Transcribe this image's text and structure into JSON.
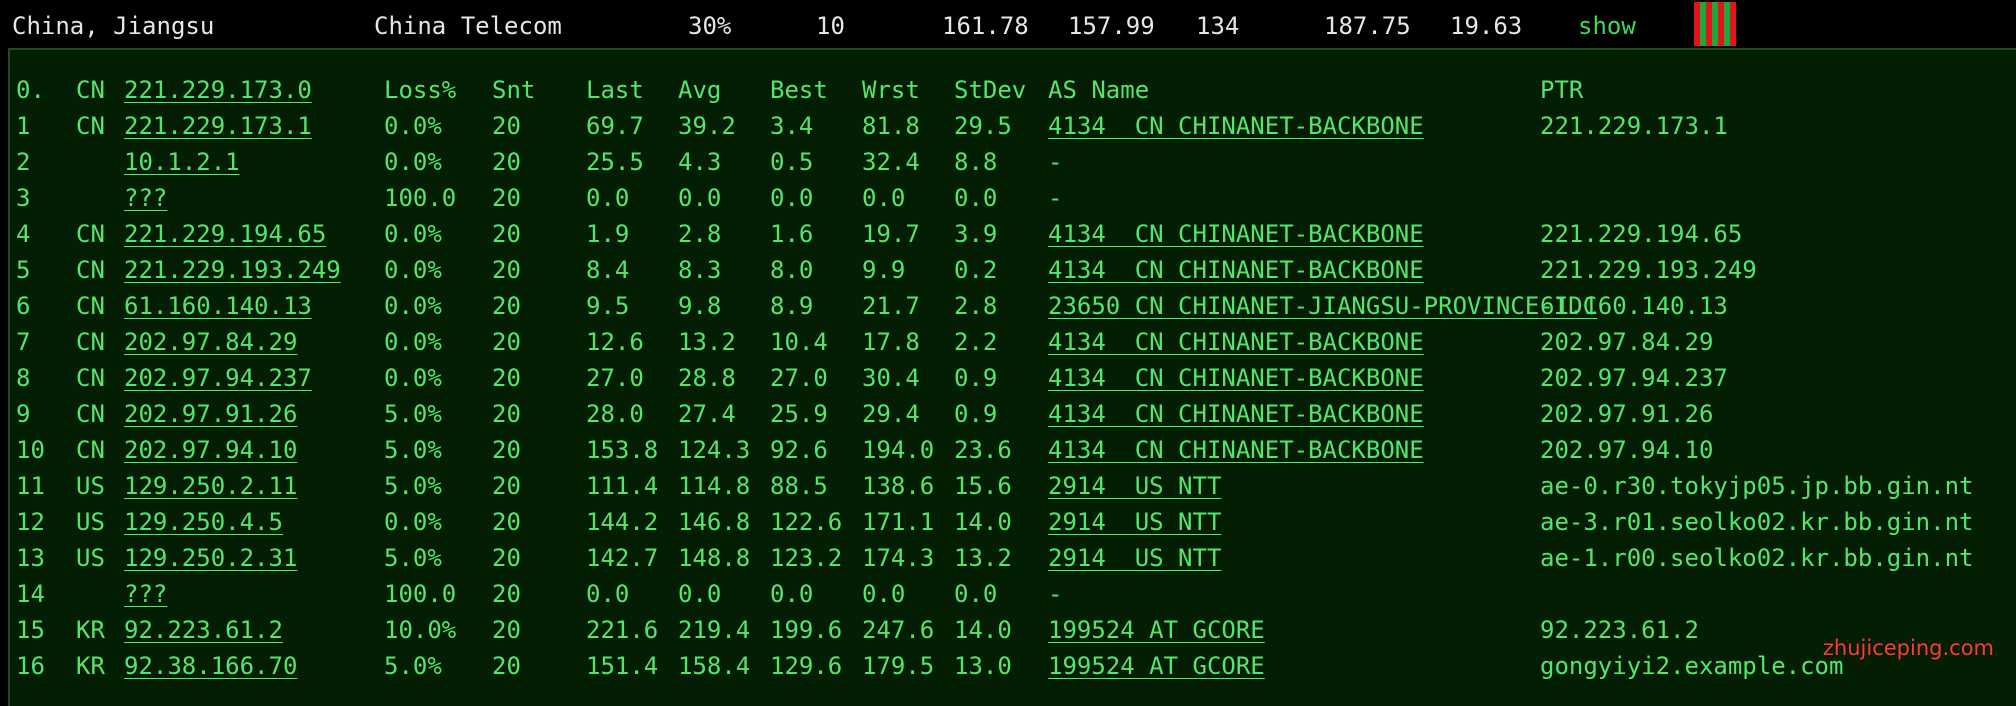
{
  "summary": {
    "location": "China, Jiangsu",
    "isp": "China Telecom",
    "loss": "30%",
    "sent": "10",
    "last": "161.78",
    "avg": "157.99",
    "best": "134",
    "worst": "187.75",
    "stdev": "19.63",
    "show_label": "show",
    "spark_bars": [
      1,
      0.35,
      1,
      0.35,
      1,
      0.35,
      1
    ]
  },
  "mtr": {
    "headers": {
      "hop": "0.",
      "cc": "CN",
      "host": "221.229.173.0",
      "loss": "Loss%",
      "snt": "Snt",
      "last": "Last",
      "avg": "Avg",
      "best": "Best",
      "wrst": "Wrst",
      "stdev": "StDev",
      "asname": "AS Name",
      "ptr": "PTR"
    },
    "rows": [
      {
        "hop": "1",
        "cc": "CN",
        "host": "221.229.173.1",
        "loss": "0.0%",
        "snt": "20",
        "last": "69.7",
        "avg": "39.2",
        "best": "3.4",
        "wrst": "81.8",
        "stdev": "29.5",
        "asname": "4134  CN CHINANET-BACKBONE",
        "ptr": "221.229.173.1"
      },
      {
        "hop": "2",
        "cc": "",
        "host": "10.1.2.1",
        "loss": "0.0%",
        "snt": "20",
        "last": "25.5",
        "avg": "4.3",
        "best": "0.5",
        "wrst": "32.4",
        "stdev": "8.8",
        "asname": "-",
        "ptr": ""
      },
      {
        "hop": "3",
        "cc": "",
        "host": "???",
        "loss": "100.0",
        "snt": "20",
        "last": "0.0",
        "avg": "0.0",
        "best": "0.0",
        "wrst": "0.0",
        "stdev": "0.0",
        "asname": "-",
        "ptr": ""
      },
      {
        "hop": "4",
        "cc": "CN",
        "host": "221.229.194.65",
        "loss": "0.0%",
        "snt": "20",
        "last": "1.9",
        "avg": "2.8",
        "best": "1.6",
        "wrst": "19.7",
        "stdev": "3.9",
        "asname": "4134  CN CHINANET-BACKBONE",
        "ptr": "221.229.194.65"
      },
      {
        "hop": "5",
        "cc": "CN",
        "host": "221.229.193.249",
        "loss": "0.0%",
        "snt": "20",
        "last": "8.4",
        "avg": "8.3",
        "best": "8.0",
        "wrst": "9.9",
        "stdev": "0.2",
        "asname": "4134  CN CHINANET-BACKBONE",
        "ptr": "221.229.193.249"
      },
      {
        "hop": "6",
        "cc": "CN",
        "host": "61.160.140.13",
        "loss": "0.0%",
        "snt": "20",
        "last": "9.5",
        "avg": "9.8",
        "best": "8.9",
        "wrst": "21.7",
        "stdev": "2.8",
        "asname": "23650 CN CHINANET-JIANGSU-PROVINCE-IDC",
        "ptr": "61.160.140.13"
      },
      {
        "hop": "7",
        "cc": "CN",
        "host": "202.97.84.29",
        "loss": "0.0%",
        "snt": "20",
        "last": "12.6",
        "avg": "13.2",
        "best": "10.4",
        "wrst": "17.8",
        "stdev": "2.2",
        "asname": "4134  CN CHINANET-BACKBONE",
        "ptr": "202.97.84.29"
      },
      {
        "hop": "8",
        "cc": "CN",
        "host": "202.97.94.237",
        "loss": "0.0%",
        "snt": "20",
        "last": "27.0",
        "avg": "28.8",
        "best": "27.0",
        "wrst": "30.4",
        "stdev": "0.9",
        "asname": "4134  CN CHINANET-BACKBONE",
        "ptr": "202.97.94.237"
      },
      {
        "hop": "9",
        "cc": "CN",
        "host": "202.97.91.26",
        "loss": "5.0%",
        "snt": "20",
        "last": "28.0",
        "avg": "27.4",
        "best": "25.9",
        "wrst": "29.4",
        "stdev": "0.9",
        "asname": "4134  CN CHINANET-BACKBONE",
        "ptr": "202.97.91.26"
      },
      {
        "hop": "10",
        "cc": "CN",
        "host": "202.97.94.10",
        "loss": "5.0%",
        "snt": "20",
        "last": "153.8",
        "avg": "124.3",
        "best": "92.6",
        "wrst": "194.0",
        "stdev": "23.6",
        "asname": "4134  CN CHINANET-BACKBONE",
        "ptr": "202.97.94.10"
      },
      {
        "hop": "11",
        "cc": "US",
        "host": "129.250.2.11",
        "loss": "5.0%",
        "snt": "20",
        "last": "111.4",
        "avg": "114.8",
        "best": "88.5",
        "wrst": "138.6",
        "stdev": "15.6",
        "asname": "2914  US NTT",
        "ptr": "ae-0.r30.tokyjp05.jp.bb.gin.nt"
      },
      {
        "hop": "12",
        "cc": "US",
        "host": "129.250.4.5",
        "loss": "0.0%",
        "snt": "20",
        "last": "144.2",
        "avg": "146.8",
        "best": "122.6",
        "wrst": "171.1",
        "stdev": "14.0",
        "asname": "2914  US NTT",
        "ptr": "ae-3.r01.seolko02.kr.bb.gin.nt"
      },
      {
        "hop": "13",
        "cc": "US",
        "host": "129.250.2.31",
        "loss": "5.0%",
        "snt": "20",
        "last": "142.7",
        "avg": "148.8",
        "best": "123.2",
        "wrst": "174.3",
        "stdev": "13.2",
        "asname": "2914  US NTT",
        "ptr": "ae-1.r00.seolko02.kr.bb.gin.nt"
      },
      {
        "hop": "14",
        "cc": "",
        "host": "???",
        "loss": "100.0",
        "snt": "20",
        "last": "0.0",
        "avg": "0.0",
        "best": "0.0",
        "wrst": "0.0",
        "stdev": "0.0",
        "asname": "-",
        "ptr": ""
      },
      {
        "hop": "15",
        "cc": "KR",
        "host": "92.223.61.2",
        "loss": "10.0%",
        "snt": "20",
        "last": "221.6",
        "avg": "219.4",
        "best": "199.6",
        "wrst": "247.6",
        "stdev": "14.0",
        "asname": "199524 AT GCORE",
        "ptr": "92.223.61.2"
      },
      {
        "hop": "16",
        "cc": "KR",
        "host": "92.38.166.70",
        "loss": "5.0%",
        "snt": "20",
        "last": "151.4",
        "avg": "158.4",
        "best": "129.6",
        "wrst": "179.5",
        "stdev": "13.0",
        "asname": "199524 AT GCORE",
        "ptr": "gongyiyi2.example.com"
      }
    ]
  },
  "watermark": "zhujiceping.com",
  "colors": {
    "background": "#000000",
    "panel": "#041e04",
    "text_green": "#54e66a",
    "summary_text": "#e6e6e6",
    "spark_green": "#1fa83a",
    "spark_red": "#e0141c",
    "watermark": "#ff3b30"
  }
}
